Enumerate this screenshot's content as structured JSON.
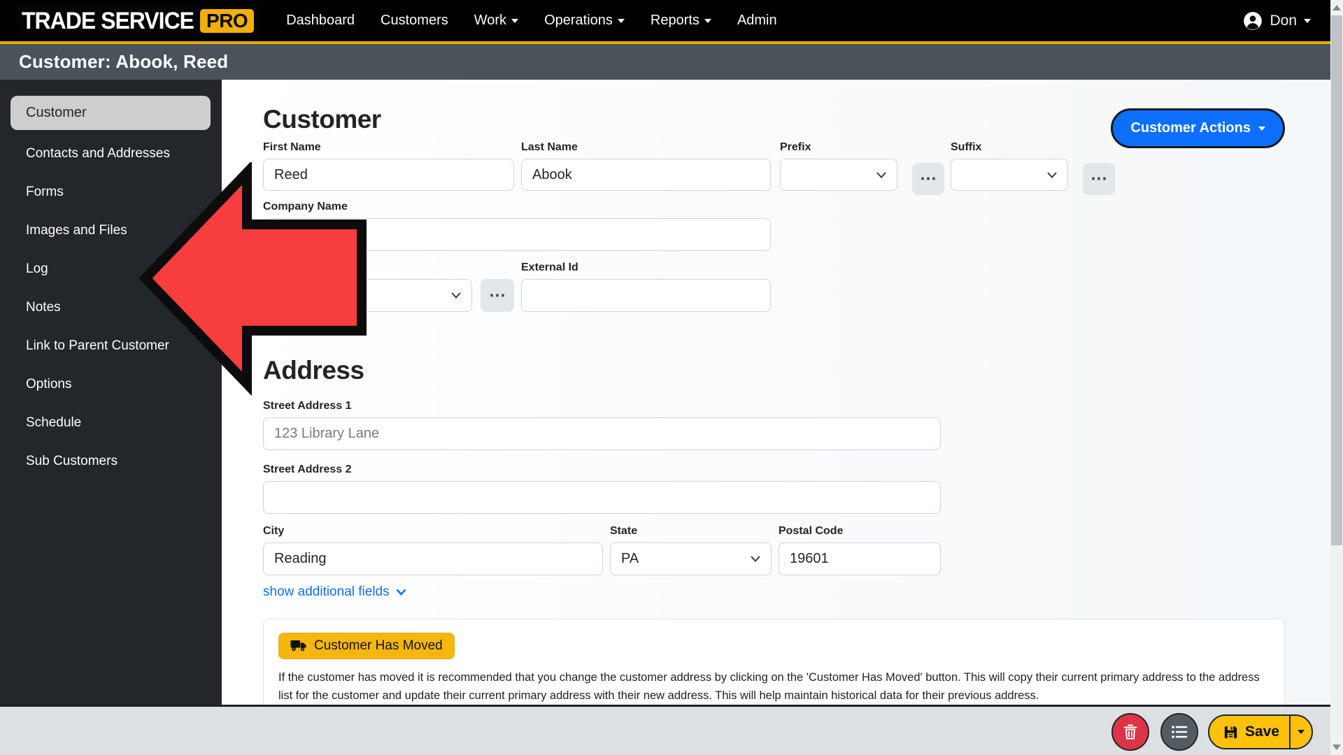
{
  "navbar": {
    "brand": {
      "name": "TRADE SERVICE",
      "badge": "PRO"
    },
    "items": [
      {
        "label": "Dashboard",
        "dropdown": false
      },
      {
        "label": "Customers",
        "dropdown": false
      },
      {
        "label": "Work",
        "dropdown": true
      },
      {
        "label": "Operations",
        "dropdown": true
      },
      {
        "label": "Reports",
        "dropdown": true
      },
      {
        "label": "Admin",
        "dropdown": false
      }
    ],
    "user": {
      "name": "Don"
    }
  },
  "page_header": {
    "title": "Customer: Abook, Reed"
  },
  "sidebar": {
    "items": [
      {
        "label": "Customer",
        "active": true
      },
      {
        "label": "Contacts and Addresses",
        "active": false
      },
      {
        "label": "Forms",
        "active": false
      },
      {
        "label": "Images and Files",
        "active": false
      },
      {
        "label": "Log",
        "active": false
      },
      {
        "label": "Notes",
        "active": false
      },
      {
        "label": "Link to Parent Customer",
        "active": false
      },
      {
        "label": "Options",
        "active": false
      },
      {
        "label": "Schedule",
        "active": false
      },
      {
        "label": "Sub Customers",
        "active": false
      }
    ]
  },
  "customer_section": {
    "title": "Customer",
    "actions_button": "Customer Actions",
    "first_name": {
      "label": "First Name",
      "value": "Reed"
    },
    "last_name": {
      "label": "Last Name",
      "value": "Abook"
    },
    "prefix": {
      "label": "Prefix",
      "value": ""
    },
    "suffix": {
      "label": "Suffix",
      "value": ""
    },
    "company_name": {
      "label": "Company Name",
      "value": ""
    },
    "type_select": {
      "value": ""
    },
    "external_id": {
      "label": "External Id",
      "value": ""
    }
  },
  "address_section": {
    "title": "Address",
    "street_address_1": {
      "label": "Street Address 1",
      "placeholder": "123 Library Lane"
    },
    "street_address_2": {
      "label": "Street Address 2",
      "value": ""
    },
    "city": {
      "label": "City",
      "value": "Reading"
    },
    "state": {
      "label": "State",
      "value": "PA"
    },
    "postal_code": {
      "label": "Postal Code",
      "value": "19601"
    },
    "show_additional_fields": "show additional fields",
    "moved_panel": {
      "button": "Customer Has Moved",
      "description": "If the customer has moved it is recommended that you change the customer address by clicking on the 'Customer Has Moved' button. This will copy their current primary address to the address list for the customer and update their current primary address with their new address. This will help maintain historical data for their previous address."
    }
  },
  "action_bar": {
    "save_label": "Save"
  },
  "icons": {
    "ellipsis": "⋯"
  },
  "colors": {
    "accent_blue": "#0d6efd",
    "warning_yellow": "#ffc107",
    "gold_line": "#e9ae06",
    "danger_red": "#dc3545",
    "arrow_red": "#f83e3e",
    "navbar_black": "#010101",
    "header_gray": "#4a525a",
    "sidebar_dark": "#23272c"
  }
}
